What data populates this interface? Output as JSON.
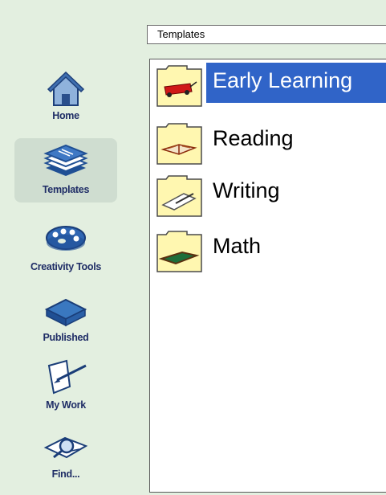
{
  "sidebar": {
    "items": [
      {
        "label": "Home",
        "icon": "house-icon"
      },
      {
        "label": "Templates",
        "icon": "templates-stack-icon",
        "selected": true
      },
      {
        "label": "Creativity Tools",
        "icon": "palette-icon"
      },
      {
        "label": "Published",
        "icon": "book-icon"
      },
      {
        "label": "My Work",
        "icon": "paper-pen-icon"
      },
      {
        "label": "Find...",
        "icon": "magnifier-icon"
      }
    ]
  },
  "path": {
    "value": "Templates"
  },
  "list": {
    "items": [
      {
        "label": "Early Learning",
        "icon": "wagon-folder-icon",
        "selected": true
      },
      {
        "label": "Reading",
        "icon": "book-folder-icon"
      },
      {
        "label": "Writing",
        "icon": "paper-folder-icon"
      },
      {
        "label": "Math",
        "icon": "chalkboard-folder-icon"
      }
    ]
  },
  "colors": {
    "background": "#e3efe0",
    "selection": "#3064c8",
    "nav_text": "#1f2d66"
  }
}
